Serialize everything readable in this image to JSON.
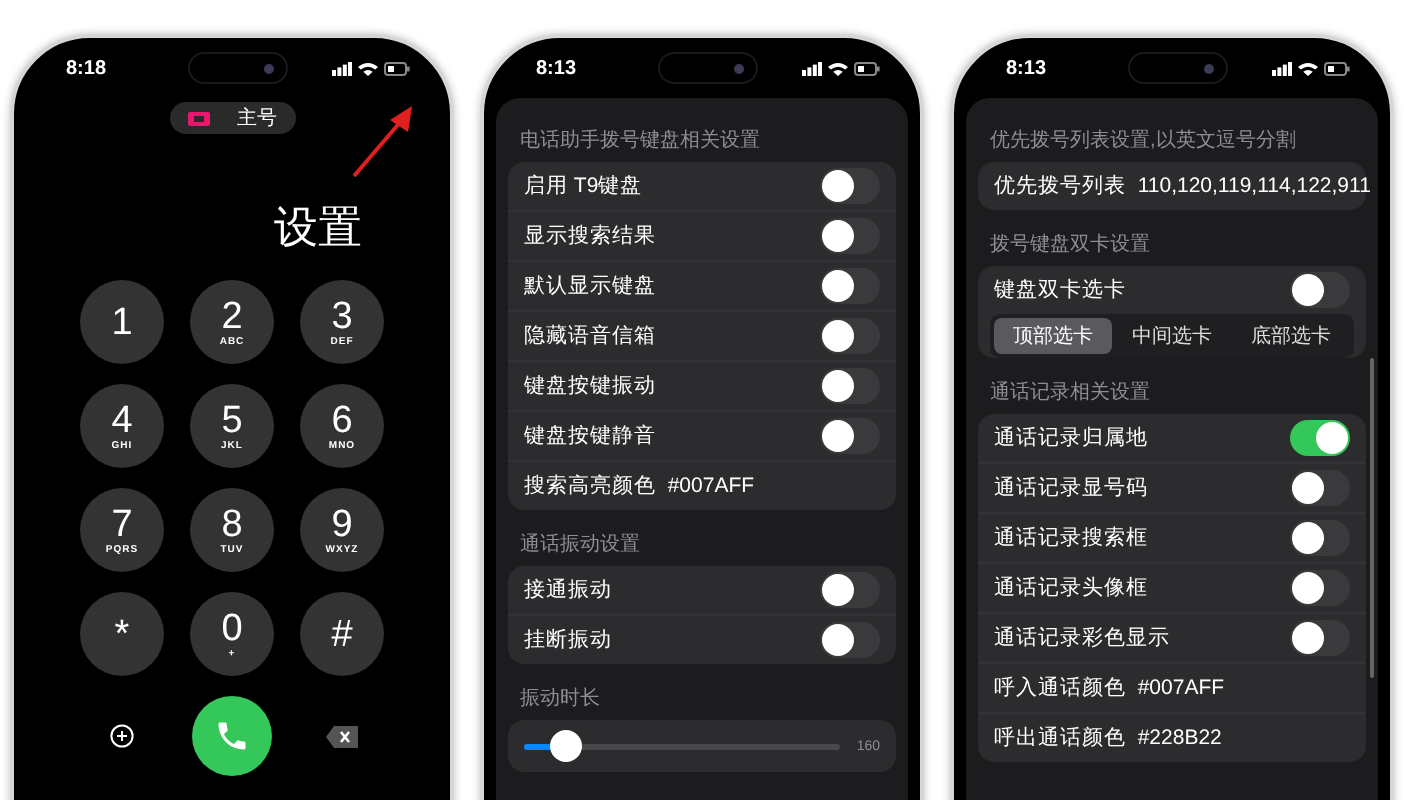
{
  "phones": [
    {
      "kind": "dialer",
      "status_time": "8:18",
      "sim_label": "主号",
      "annotation": "设置",
      "keys": [
        {
          "digit": "1"
        },
        {
          "digit": "2",
          "letters": "ABC"
        },
        {
          "digit": "3",
          "letters": "DEF"
        },
        {
          "digit": "4",
          "letters": "GHI"
        },
        {
          "digit": "5",
          "letters": "JKL"
        },
        {
          "digit": "6",
          "letters": "MNO"
        },
        {
          "digit": "7",
          "letters": "PQRS"
        },
        {
          "digit": "8",
          "letters": "TUV"
        },
        {
          "digit": "9",
          "letters": "WXYZ"
        },
        {
          "digit": "*"
        },
        {
          "digit": "0",
          "letters": "+"
        },
        {
          "digit": "#"
        }
      ]
    },
    {
      "kind": "settings",
      "status_time": "8:13",
      "scrollbar": false,
      "sections": [
        {
          "header": "电话助手拨号键盘相关设置",
          "rows": [
            {
              "kind": "toggle",
              "label": "启用 T9键盘",
              "on": false
            },
            {
              "kind": "toggle",
              "label": "显示搜索结果",
              "on": false
            },
            {
              "kind": "toggle",
              "label": "默认显示键盘",
              "on": false
            },
            {
              "kind": "toggle",
              "label": "隐藏语音信箱",
              "on": false
            },
            {
              "kind": "toggle",
              "label": "键盘按键振动",
              "on": false
            },
            {
              "kind": "toggle",
              "label": "键盘按键静音",
              "on": false
            },
            {
              "kind": "value",
              "label": "搜索高亮颜色",
              "value": "#007AFF"
            }
          ]
        },
        {
          "header": "通话振动设置",
          "rows": [
            {
              "kind": "toggle",
              "label": "接通振动",
              "on": false
            },
            {
              "kind": "toggle",
              "label": "挂断振动",
              "on": false
            }
          ]
        },
        {
          "header": "振动时长",
          "rows": [
            {
              "kind": "slider",
              "level": 0.13,
              "reading": "160"
            }
          ]
        }
      ]
    },
    {
      "kind": "settings",
      "status_time": "8:13",
      "scrollbar": true,
      "sections": [
        {
          "header": "优先拨号列表设置,以英文逗号分割",
          "rows": [
            {
              "kind": "value",
              "label": "优先拨号列表",
              "value": "110,120,119,114,122,911"
            }
          ]
        },
        {
          "header": "拨号键盘双卡设置",
          "rows": [
            {
              "kind": "toggle",
              "label": "键盘双卡选卡",
              "on": false
            },
            {
              "kind": "segmented",
              "options": [
                {
                  "label": "顶部选卡",
                  "selected": true
                },
                {
                  "label": "中间选卡",
                  "selected": false
                },
                {
                  "label": "底部选卡",
                  "selected": false
                }
              ]
            }
          ]
        },
        {
          "header": "通话记录相关设置",
          "rows": [
            {
              "kind": "toggle",
              "label": "通话记录归属地",
              "on": true
            },
            {
              "kind": "toggle",
              "label": "通话记录显号码",
              "on": false
            },
            {
              "kind": "toggle",
              "label": "通话记录搜索框",
              "on": false
            },
            {
              "kind": "toggle",
              "label": "通话记录头像框",
              "on": false
            },
            {
              "kind": "toggle",
              "label": "通话记录彩色显示",
              "on": false
            },
            {
              "kind": "value",
              "label": "呼入通话颜色",
              "value": "#007AFF"
            },
            {
              "kind": "value",
              "label": "呼出通话颜色",
              "value": "#228B22"
            }
          ]
        }
      ]
    }
  ]
}
